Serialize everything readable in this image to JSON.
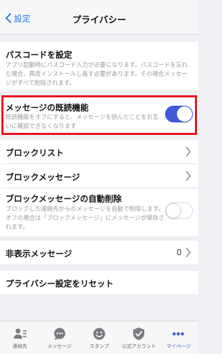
{
  "header": {
    "back_label": "設定",
    "title": "プライバシー"
  },
  "passcode": {
    "title": "パスコードを設定",
    "description": "アプリ起動時にパスコード入力が必要になります。パスコードを忘れた場合、再度インストールし直す必要があります。その場合メッセージがすべて削除されます。"
  },
  "read_receipts": {
    "title": "メッセージの既読機能",
    "description": "既読機能をオフにすると、メッセージを読んだことをお互いに確認できなくなります",
    "toggle_state": "on"
  },
  "block_list": {
    "title": "ブロックリスト"
  },
  "block_messages": {
    "title": "ブロックメッセージ"
  },
  "auto_delete_block": {
    "title": "ブロックメッセージの自動削除",
    "description": "ブロックした連絡先からのメッセージを自動で削除します。オフの場合は「ブロックメッセージ」にメッセージが保存されます。",
    "toggle_state": "off"
  },
  "hidden_messages": {
    "title": "非表示メッセージ",
    "count": "0"
  },
  "reset_privacy": {
    "title": "プライバシー設定をリセット"
  },
  "tabbar": {
    "items": [
      {
        "label": "連絡先",
        "icon": "contacts-icon"
      },
      {
        "label": "メッセージ",
        "icon": "chat-bubble-icon"
      },
      {
        "label": "スタンプ",
        "icon": "smiley-icon"
      },
      {
        "label": "公式アカウント",
        "icon": "shield-check-icon"
      },
      {
        "label": "マイページ",
        "icon": "more-dots-icon"
      }
    ],
    "active_index": 4
  },
  "colors": {
    "accent": "#3f5ad6",
    "link": "#2a7be4",
    "highlight_border": "#e8121d",
    "background": "#efeff4"
  }
}
